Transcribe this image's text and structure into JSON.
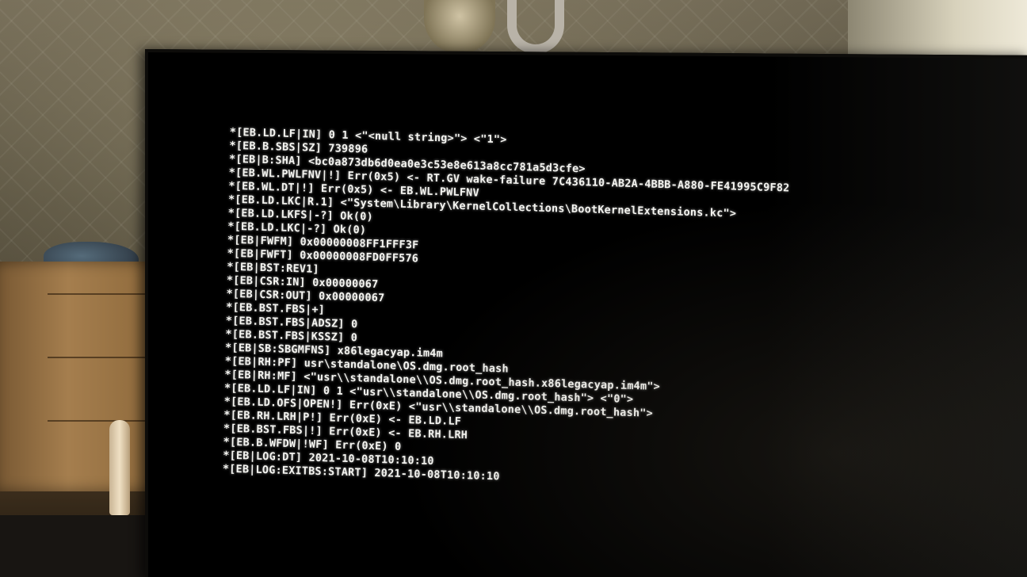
{
  "boot_log": {
    "lines": [
      "*[EB.LD.LF|IN] 0 1 <\"<null string>\"> <\"1\">",
      "*[EB.B.SBS|SZ] 739896",
      "*[EB|B:SHA] <bc0a873db6d0ea0e3c53e8e613a8cc781a5d3cfe>",
      "*[EB.WL.PWLFNV|!] Err(0x5) <- RT.GV wake-failure 7C436110-AB2A-4BBB-A880-FE41995C9F82",
      "*[EB.WL.DT|!] Err(0x5) <- EB.WL.PWLFNV",
      "*[EB.LD.LKC|R.1] <\"System\\Library\\KernelCollections\\BootKernelExtensions.kc\">",
      "*[EB.LD.LKFS|-?] Ok(0)",
      "*[EB.LD.LKC|-?] Ok(0)",
      "*[EB|FWFM] 0x00000008FF1FFF3F",
      "*[EB|FWFT] 0x00000008FD0FF576",
      "*[EB|BST:REV1]",
      "*[EB|CSR:IN] 0x00000067",
      "*[EB|CSR:OUT] 0x00000067",
      "*[EB.BST.FBS|+]",
      "*[EB.BST.FBS|ADSZ] 0",
      "*[EB.BST.FBS|KSSZ] 0",
      "*[EB|SB:SBGMFNS] x86legacyap.im4m",
      "*[EB|RH:PF] usr\\standalone\\OS.dmg.root_hash",
      "*[EB|RH:MF] <\"usr\\\\standalone\\\\OS.dmg.root_hash.x86legacyap.im4m\">",
      "*[EB.LD.LF|IN] 0 1 <\"usr\\\\standalone\\\\OS.dmg.root_hash\"> <\"0\">",
      "*[EB.LD.OFS|OPEN!] Err(0xE) <\"usr\\\\standalone\\\\OS.dmg.root_hash\">",
      "*[EB.RH.LRH|P!] Err(0xE) <- EB.LD.LF",
      "*[EB.BST.FBS|!] Err(0xE) <- EB.RH.LRH",
      "*[EB.B.WFDW|!WF] Err(0xE) 0",
      "*[EB|LOG:DT] 2021-10-08T10:10:10",
      "*[EB|LOG:EXITBS:START] 2021-10-08T10:10:10"
    ]
  },
  "colors": {
    "screen_background": "#000000",
    "log_text": "#f4f4f0"
  }
}
